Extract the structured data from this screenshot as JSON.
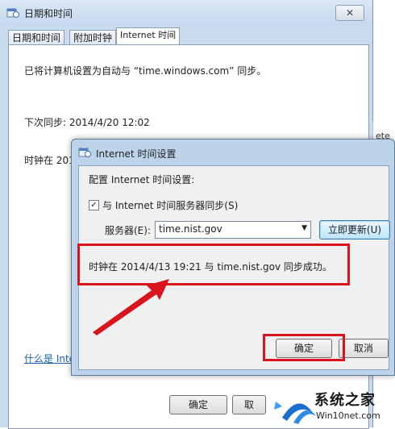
{
  "bg_window": {
    "title": "日期和时间",
    "close_glyph": "✕",
    "tabs": [
      "日期和时间",
      "附加时钟",
      "Internet 时间"
    ],
    "sync_message": "已将计算机设置为自动与 “time.windows.com” 同步。",
    "next_sync": "下次同步: 2014/4/20 12:02",
    "clock_partial": "时钟在 201",
    "link_partial": "什么是 Inte",
    "ok_label": "确定",
    "cancel_partial": "取"
  },
  "peek_window": {
    "text": "ete"
  },
  "dialog": {
    "title": "Internet 时间设置",
    "config_label": "配置 Internet 时间设置:",
    "sync_checkbox_label": "与 Internet 时间服务器同步(S)",
    "sync_checked": true,
    "check_glyph": "✓",
    "server_label": "服务器(E):",
    "server_value": "time.nist.gov",
    "update_button": "立即更新(U)",
    "status_message": "时钟在 2014/4/13 19:21 与 time.nist.gov 同步成功。",
    "ok_label": "确定",
    "cancel_label": "取消"
  },
  "watermark": {
    "brand": "系统之家",
    "url": "Win10net.com"
  },
  "colors": {
    "annotation_red": "#d9141d",
    "titlebar": "#c5d8ee",
    "link": "#1a5fb4"
  }
}
